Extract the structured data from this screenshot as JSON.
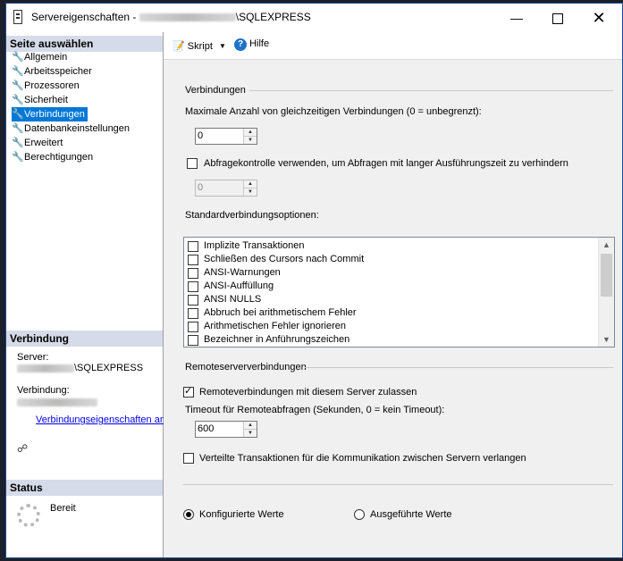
{
  "window": {
    "title_prefix": "Servereigenschaften - ",
    "title_suffix": "\\SQLEXPRESS",
    "minimize_icon": "minimize-icon",
    "maximize_icon": "maximize-icon",
    "close_icon": "close-icon"
  },
  "left_pane": {
    "select_page_header": "Seite auswählen",
    "pages": [
      {
        "label": "Allgemein",
        "icon": "wrench-icon",
        "selected": false
      },
      {
        "label": "Arbeitsspeicher",
        "icon": "wrench-icon",
        "selected": false
      },
      {
        "label": "Prozessoren",
        "icon": "wrench-icon",
        "selected": false
      },
      {
        "label": "Sicherheit",
        "icon": "wrench-icon",
        "selected": false
      },
      {
        "label": "Verbindungen",
        "icon": "wrench-icon",
        "selected": true
      },
      {
        "label": "Datenbankeinstellungen",
        "icon": "wrench-icon",
        "selected": false
      },
      {
        "label": "Erweitert",
        "icon": "wrench-icon",
        "selected": false
      },
      {
        "label": "Berechtigungen",
        "icon": "wrench-icon",
        "selected": false
      }
    ],
    "connection_header": "Verbindung",
    "server_label": "Server:",
    "server_value": "\\SQLEXPRESS",
    "connection_label": "Verbindung:",
    "connection_properties_link": "Verbindungseigenschaften anzeigen",
    "status_header": "Status",
    "status_value": "Bereit"
  },
  "toolbar": {
    "script_label": "Skript",
    "help_label": "Hilfe"
  },
  "connections": {
    "section_title": "Verbindungen",
    "max_connections_label": "Maximale Anzahl von gleichzeitigen Verbindungen (0 = unbegrenzt):",
    "max_connections_value": "0",
    "query_governor_label": "Abfragekontrolle verwenden, um Abfragen mit langer Ausführungszeit zu verhindern",
    "query_governor_checked": false,
    "query_governor_value": "0",
    "default_options_label": "Standardverbindungsoptionen:",
    "default_options": [
      {
        "label": "Implizite Transaktionen",
        "checked": false
      },
      {
        "label": "Schließen des Cursors nach Commit",
        "checked": false
      },
      {
        "label": "ANSI-Warnungen",
        "checked": false
      },
      {
        "label": "ANSI-Auffüllung",
        "checked": false
      },
      {
        "label": "ANSI NULLS",
        "checked": false
      },
      {
        "label": "Abbruch bei arithmetischem Fehler",
        "checked": false
      },
      {
        "label": "Arithmetischen Fehler ignorieren",
        "checked": false
      },
      {
        "label": "Bezeichner in Anführungszeichen",
        "checked": false
      }
    ]
  },
  "remote": {
    "section_title": "Remoteserververbindungen",
    "allow_remote_label": "Remoteverbindungen mit diesem Server zulassen",
    "allow_remote_checked": true,
    "timeout_label": "Timeout für Remoteabfragen (Sekunden, 0 = kein Timeout):",
    "timeout_value": "600",
    "distributed_tx_label": "Verteilte Transaktionen für die Kommunikation zwischen Servern verlangen",
    "distributed_tx_checked": false
  },
  "values_mode": {
    "configured_label": "Konfigurierte Werte",
    "running_label": "Ausgeführte Werte",
    "selected": "configured"
  }
}
